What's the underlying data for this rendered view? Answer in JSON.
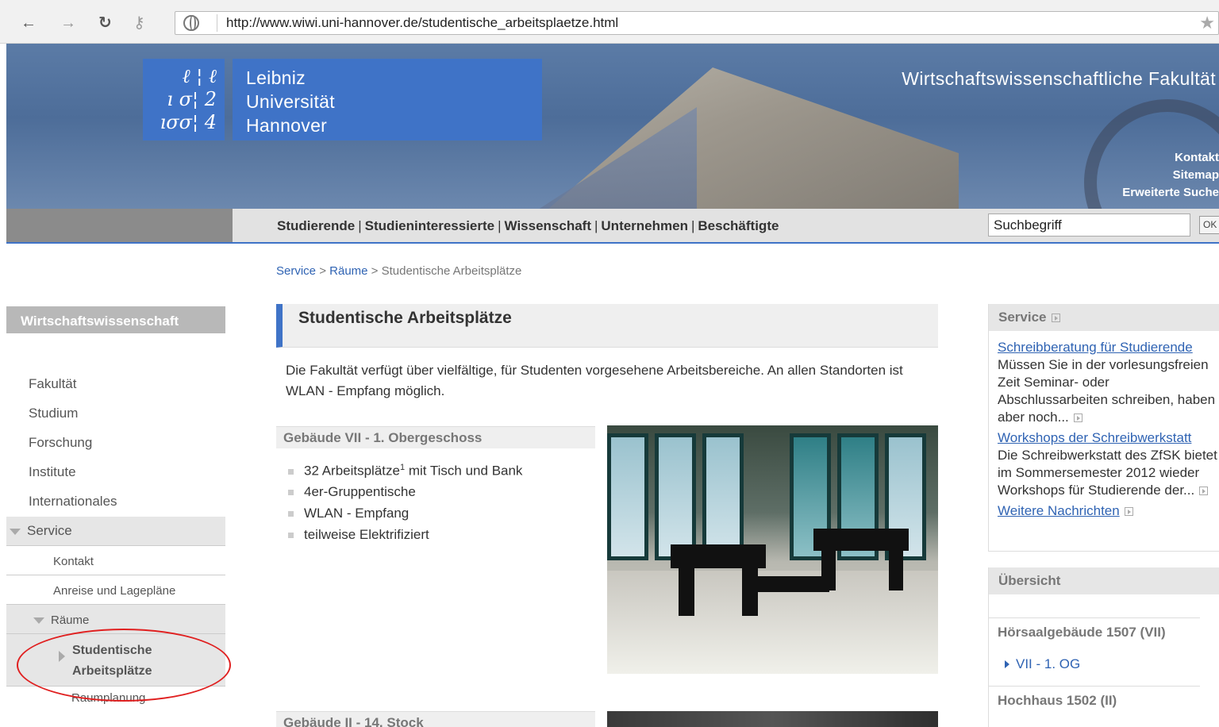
{
  "browser": {
    "url": "http://www.wiwi.uni-hannover.de/studentische_arbeitsplaetze.html",
    "back_icon": "←",
    "forward_icon": "→",
    "reload_icon": "↻",
    "key_icon": "⚷",
    "star_icon": "★"
  },
  "header": {
    "logo_mark_lines": [
      "ℓ ¦ ℓ",
      "ı σ¦ 2",
      "ıσσ¦ 4"
    ],
    "logo_text": [
      "Leibniz",
      "Universität",
      "Hannover"
    ],
    "faculty": "Wirtschaftswissenschaftliche Fakultät",
    "top_links": [
      "Kontakt",
      "Sitemap",
      "Erweiterte Suche"
    ]
  },
  "nav": {
    "groups": [
      "Studierende",
      "Studieninteressierte",
      "Wissenschaft",
      "Unternehmen",
      "Beschäftigte"
    ],
    "search_value": "Suchbegriff",
    "ok_label": "OK"
  },
  "breadcrumb": {
    "items": [
      "Service",
      "Räume"
    ],
    "separator": ">",
    "current": "Studentische Arbeitsplätze"
  },
  "sidebar": {
    "heading": "Wirtschaftswissenschaft",
    "items": [
      "Fakultät",
      "Studium",
      "Forschung",
      "Institute",
      "Internationales"
    ],
    "service": "Service",
    "sub_items": [
      "Kontakt",
      "Anreise und Lagepläne"
    ],
    "raeume": "Räume",
    "active": [
      "Studentische",
      "Arbeitsplätze"
    ],
    "next": "Raumplanung"
  },
  "main": {
    "title": "Studentische Arbeitsplätze",
    "intro": "Die Fakultät verfügt über vielfältige, für Studenten vorgesehene Arbeitsbereiche. An allen Standorten ist WLAN - Empfang möglich.",
    "section1": {
      "heading": "Gebäude VII - 1. Obergeschoss",
      "item1_pre": "32 Arbeitsplätze",
      "item1_sup": "1",
      "item1_post": " mit Tisch und Bank",
      "items": [
        "4er-Gruppentische",
        "WLAN - Empfang",
        "teilweise Elektrifiziert"
      ]
    },
    "section2": {
      "heading": "Gebäude II - 14. Stock"
    }
  },
  "right": {
    "service_heading": "Service",
    "news": [
      {
        "title": "Schreibberatung für Studierende",
        "body": "Müssen Sie in der vorlesungsfreien Zeit Seminar- oder Abschlussarbeiten schreiben, haben aber noch..."
      },
      {
        "title": "Workshops der Schreibwerkstatt",
        "body": "Die Schreibwerkstatt des ZfSK bietet im Sommersemester 2012 wieder Workshops für Studierende der..."
      }
    ],
    "more_news": "Weitere Nachrichten",
    "overview_heading": "Übersicht",
    "buildings": [
      "Hörsaalgebäude 1507 (VII)",
      "Hochhaus 1502 (II)"
    ],
    "building_link": "VII - 1. OG"
  }
}
